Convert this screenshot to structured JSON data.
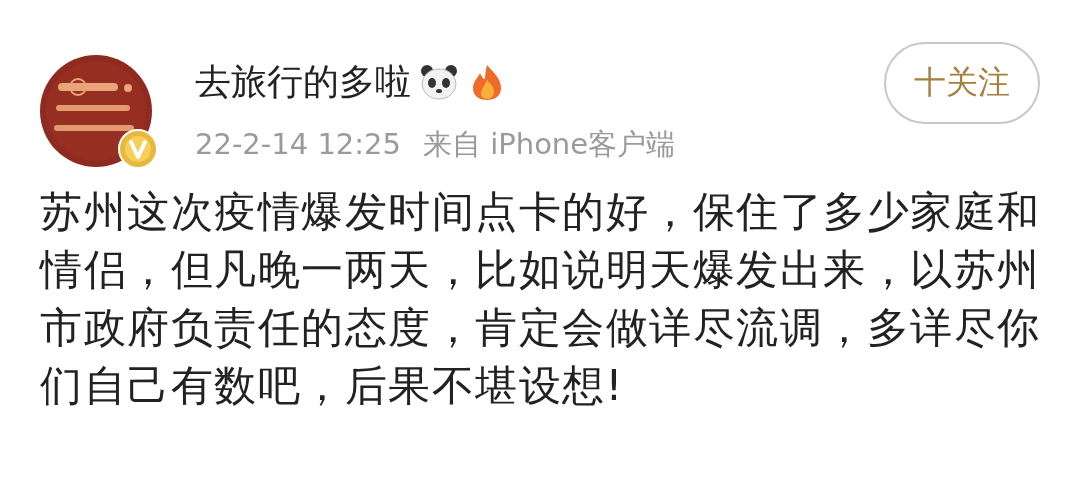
{
  "post": {
    "author": {
      "name": "去旅行的多啦",
      "avatar": {
        "kind": "picture",
        "verified": true
      }
    },
    "time": "22-2-14 12:25",
    "source": "来自 iPhone客户端",
    "follow_button": "十关注",
    "text": "苏州这次疫情爆发时间点卡的好，保住了多少家庭和情侣，但凡晚一两天，比如说明天爆发出来，以苏州市政府负责任的态度，肯定会做详尽流调，多详尽你们自己有数吧，后果不堪设想!"
  }
}
